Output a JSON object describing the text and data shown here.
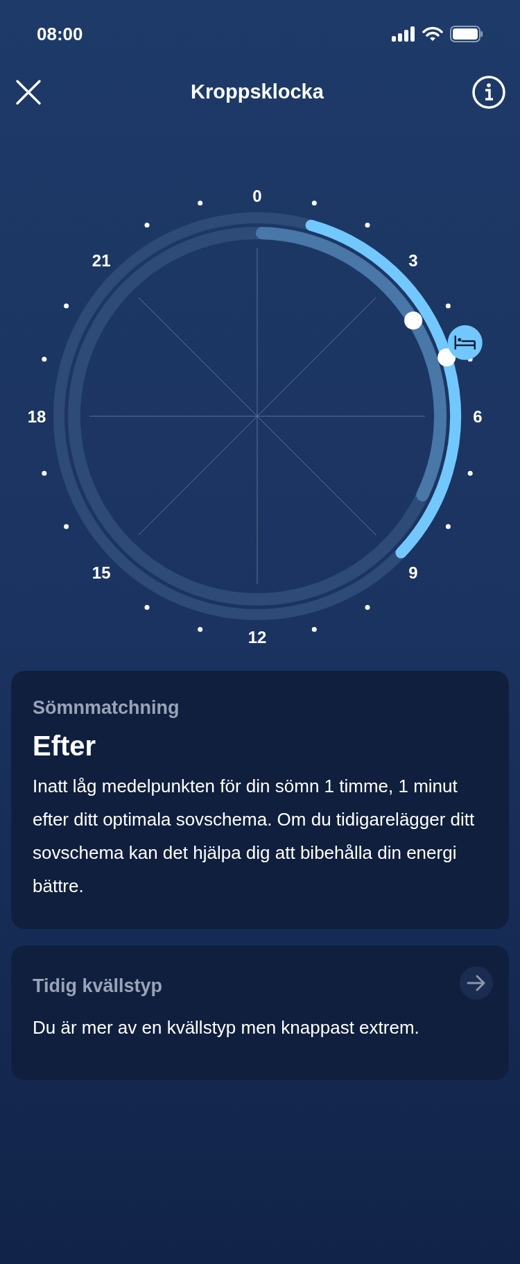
{
  "status_bar": {
    "time": "08:00"
  },
  "nav": {
    "title": "Kroppsklocka"
  },
  "clock": {
    "hour_labels": [
      "0",
      "3",
      "6",
      "9",
      "12",
      "15",
      "18",
      "21"
    ]
  },
  "cards": [
    {
      "kind": "info",
      "label": "Sömnmatchning",
      "value": "Efter",
      "text": "Inatt låg medelpunkten för din sömn 1 timme, 1 minut efter ditt optimala sovschema. Om du tidigarelägger ditt sovschema kan det hjälpa dig att bibehålla din energi bättre."
    },
    {
      "kind": "link",
      "label": "Tidig kvällstyp",
      "text": "Du är mer av en kvällstyp men knappast extrem."
    }
  ]
}
